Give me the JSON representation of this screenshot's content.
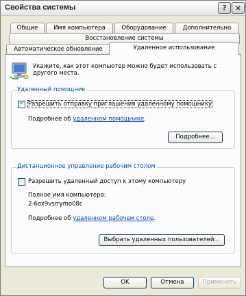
{
  "window": {
    "title": "Свойства системы",
    "help_label": "?",
    "close_label": "×"
  },
  "tabs": {
    "row1": [
      {
        "label": "Общие"
      },
      {
        "label": "Имя компьютера"
      },
      {
        "label": "Оборудование"
      },
      {
        "label": "Дополнительно"
      }
    ],
    "row2": [
      {
        "label": "Восстановление системы"
      }
    ],
    "row3": [
      {
        "label": "Автоматическое обновление"
      },
      {
        "label": "Удаленное использование"
      }
    ]
  },
  "intro": {
    "line1": "Укажите, как этот компьютер можно будет использовать с",
    "line2": "другого места."
  },
  "remote_assistance": {
    "title": "Удаленный помощник",
    "checkbox_label": "Разрешить отправку приглашения удаленному помощнику",
    "checked": true,
    "more_prefix": "Подробнее об ",
    "more_link": "удаленном помощнике",
    "more_suffix": ".",
    "advanced_button": "Подробнее..."
  },
  "remote_desktop": {
    "title": "Дистанционное управление рабочим столом",
    "checkbox_label": "Разрешить удаленный доступ к этому компьютеру",
    "checked": false,
    "full_name_label": "Полное имя компьютера:",
    "computer_name": "2-6ox9vsrrymo08c",
    "more_prefix": "Подробнее об ",
    "more_link": "удаленном рабочем столе",
    "more_suffix": ".",
    "select_users_button": "Выбрать удаленных пользователей..."
  },
  "footer": {
    "ok": "OK",
    "cancel": "Отмена",
    "apply": "Применить"
  }
}
